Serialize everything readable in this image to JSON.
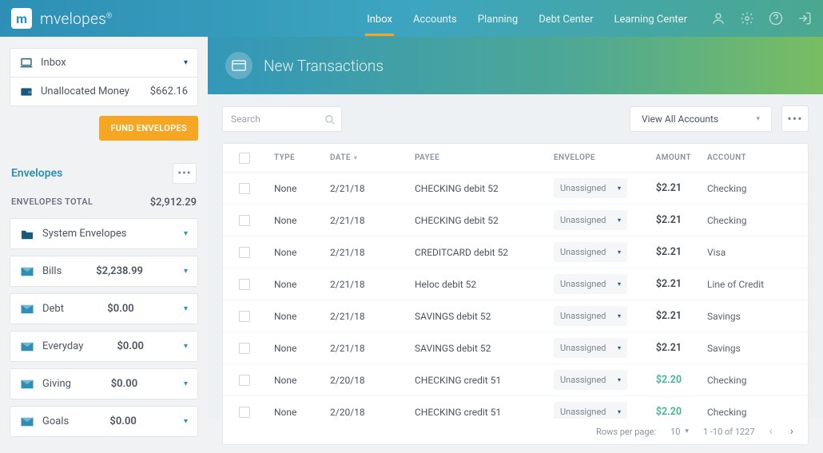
{
  "brand": "mvelopes",
  "nav": {
    "items": [
      "Inbox",
      "Accounts",
      "Planning",
      "Debt Center",
      "Learning Center"
    ],
    "active": 0
  },
  "sidebar": {
    "inbox_label": "Inbox",
    "unallocated_label": "Unallocated Money",
    "unallocated_amount": "$662.16",
    "fund_btn": "FUND ENVELOPES",
    "section_title": "Envelopes",
    "totals_label": "ENVELOPES TOTAL",
    "totals_value": "$2,912.29",
    "envelopes": [
      {
        "name": "System Envelopes",
        "amount": "",
        "type": "folder"
      },
      {
        "name": "Bills",
        "amount": "$2,238.99",
        "type": "env"
      },
      {
        "name": "Debt",
        "amount": "$0.00",
        "type": "env"
      },
      {
        "name": "Everyday",
        "amount": "$0.00",
        "type": "env"
      },
      {
        "name": "Giving",
        "amount": "$0.00",
        "type": "env"
      },
      {
        "name": "Goals",
        "amount": "$0.00",
        "type": "env"
      }
    ]
  },
  "banner": {
    "title": "New Transactions"
  },
  "toolbar": {
    "search_placeholder": "Search",
    "accounts_label": "View All Accounts"
  },
  "table": {
    "columns": {
      "type": "TYPE",
      "date": "DATE",
      "payee": "PAYEE",
      "envelope": "ENVELOPE",
      "amount": "AMOUNT",
      "account": "ACCOUNT"
    },
    "rows": [
      {
        "type": "None",
        "date": "2/21/18",
        "payee": "CHECKING debit 52",
        "envelope": "Unassigned",
        "amount": "$2.21",
        "pos": false,
        "account": "Checking"
      },
      {
        "type": "None",
        "date": "2/21/18",
        "payee": "CHECKING debit 52",
        "envelope": "Unassigned",
        "amount": "$2.21",
        "pos": false,
        "account": "Checking"
      },
      {
        "type": "None",
        "date": "2/21/18",
        "payee": "CREDITCARD debit 52",
        "envelope": "Unassigned",
        "amount": "$2.21",
        "pos": false,
        "account": "Visa"
      },
      {
        "type": "None",
        "date": "2/21/18",
        "payee": "Heloc debit 52",
        "envelope": "Unassigned",
        "amount": "$2.21",
        "pos": false,
        "account": "Line of Credit"
      },
      {
        "type": "None",
        "date": "2/21/18",
        "payee": "SAVINGS debit 52",
        "envelope": "Unassigned",
        "amount": "$2.21",
        "pos": false,
        "account": "Savings"
      },
      {
        "type": "None",
        "date": "2/21/18",
        "payee": "SAVINGS debit 52",
        "envelope": "Unassigned",
        "amount": "$2.21",
        "pos": false,
        "account": "Savings"
      },
      {
        "type": "None",
        "date": "2/20/18",
        "payee": "CHECKING credit 51",
        "envelope": "Unassigned",
        "amount": "$2.20",
        "pos": true,
        "account": "Checking"
      },
      {
        "type": "None",
        "date": "2/20/18",
        "payee": "CHECKING credit 51",
        "envelope": "Unassigned",
        "amount": "$2.20",
        "pos": true,
        "account": "Checking"
      }
    ]
  },
  "pager": {
    "rpp_label": "Rows per page:",
    "rpp_value": "10",
    "range": "1 -10 of 1227"
  }
}
